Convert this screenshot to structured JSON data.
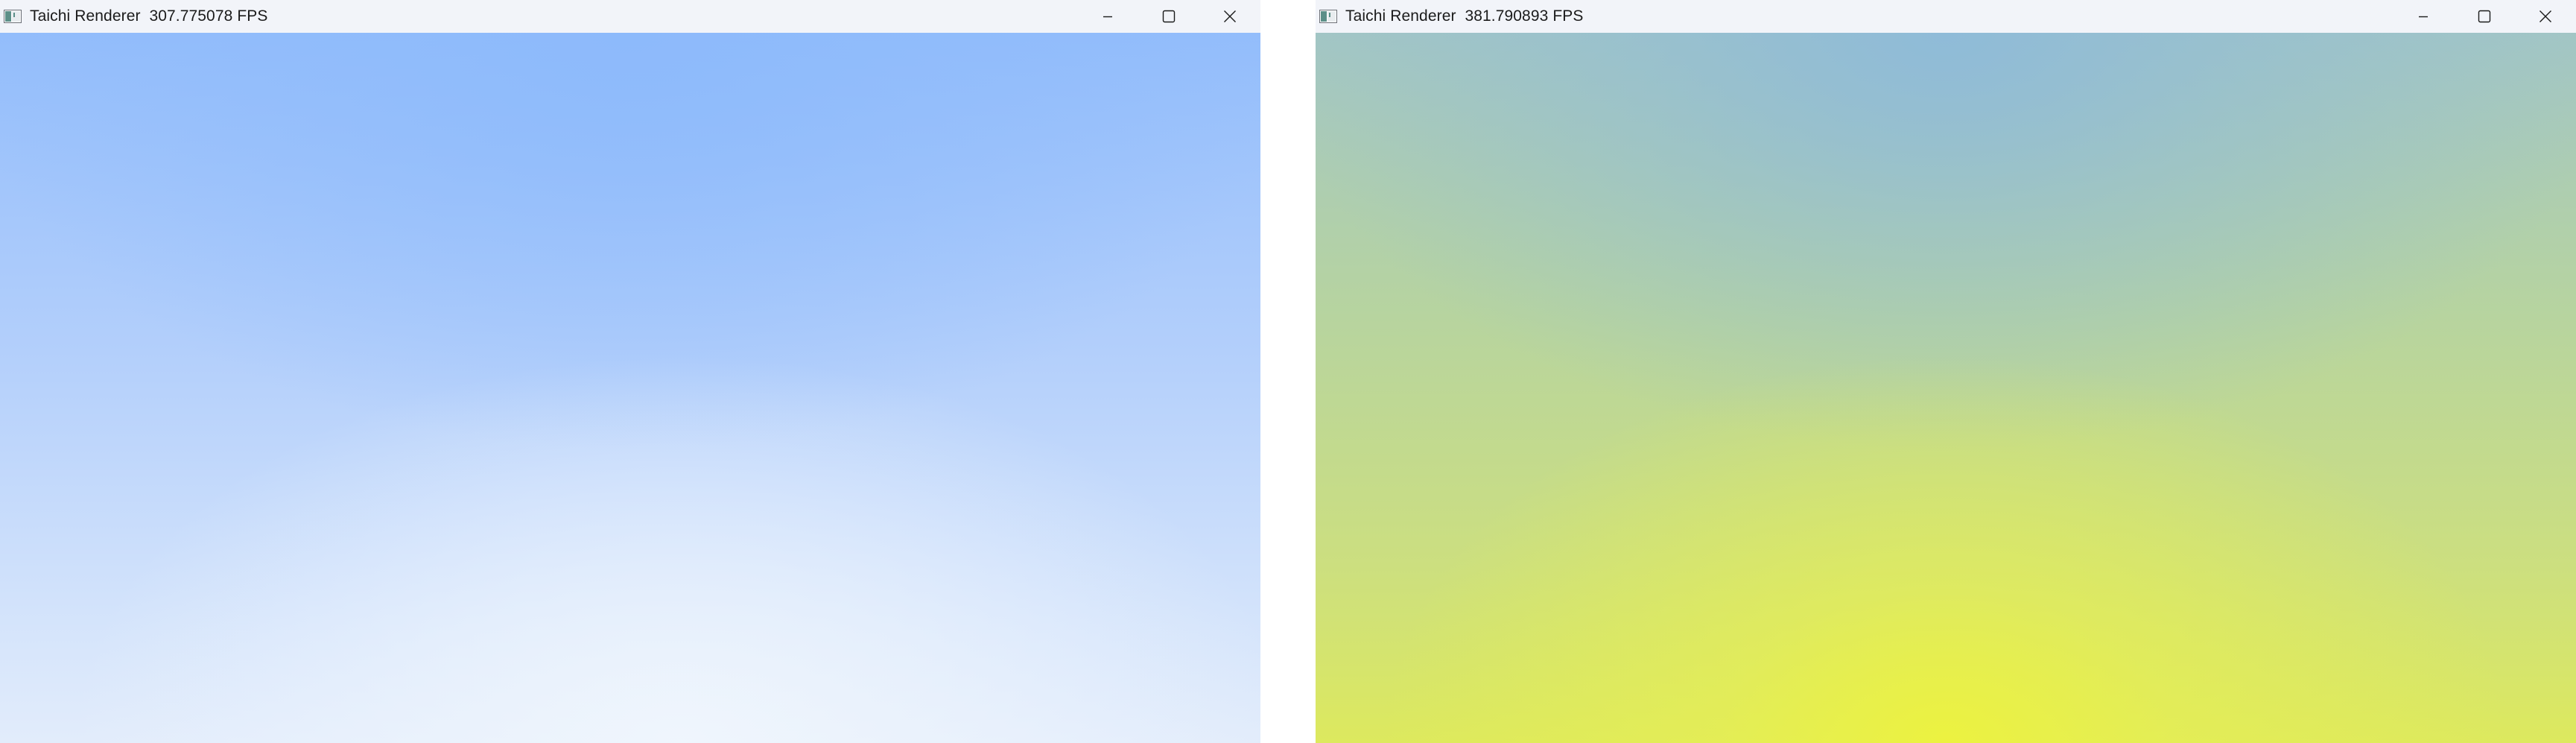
{
  "windows": [
    {
      "title": "Taichi Renderer  307.775078 FPS",
      "canvas_colors": {
        "top": "#8dbafb",
        "bottom": "#f0f6fd"
      }
    },
    {
      "title": "Taichi Renderer  381.790893 FPS",
      "canvas_colors": {
        "top": "#8fbbd8",
        "bottom": "#ecf240"
      }
    }
  ],
  "icons": {
    "app": "app-window-icon",
    "minimize": "minimize-icon",
    "maximize": "maximize-icon",
    "close": "close-icon"
  },
  "colors": {
    "titlebar_bg": "#f2f4f9",
    "title_text": "#1b1b1b"
  }
}
